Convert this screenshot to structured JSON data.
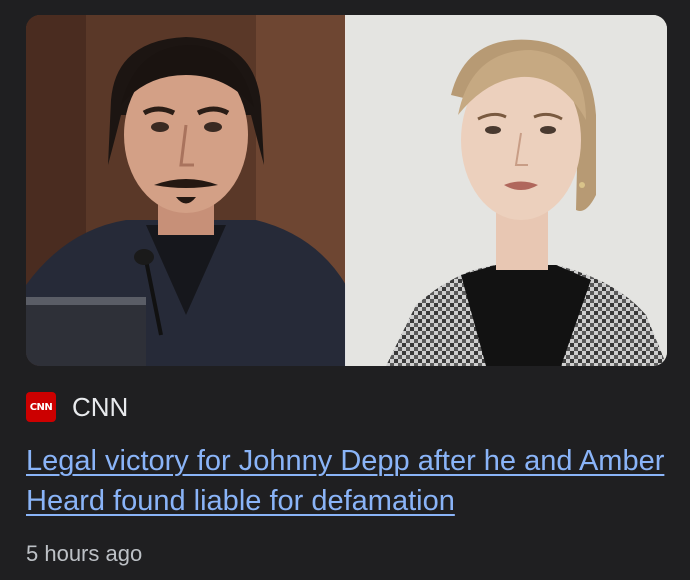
{
  "article": {
    "source": {
      "logo_text": "CNN",
      "logo_color": "#cc0000",
      "name": "CNN"
    },
    "headline": "Legal victory for Johnny Depp after he and Amber Heard found liable for defamation",
    "timestamp": "5 hours ago",
    "link_color": "#8ab4f8"
  }
}
